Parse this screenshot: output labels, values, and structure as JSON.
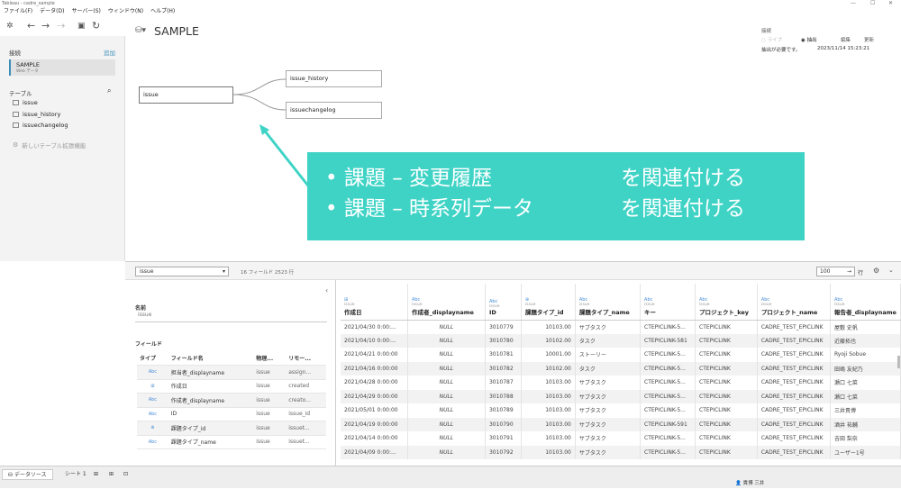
{
  "window": {
    "title": "Tableau - cadre_sample"
  },
  "menu": [
    "ファイル(F)",
    "データ(D)",
    "サーバー(S)",
    "ウィンドウ(N)",
    "ヘルプ(H)"
  ],
  "left": {
    "connections_label": "接続",
    "add_label": "追加",
    "connection_name": "SAMPLE",
    "connection_sub": "Web データ",
    "tables_label": "テーブル",
    "tables": [
      "issue",
      "issue_history",
      "issuechangelog"
    ],
    "new_table_ext": "新しいテーブル拡張機能"
  },
  "canvas": {
    "datasource_title": "SAMPLE",
    "connection_label": "接続",
    "live_label": "ライブ",
    "extract_label": "抽出",
    "edit_label": "編集",
    "refresh_label": "更新",
    "status": "抽出が必要です。",
    "timestamp": "2023/11/14 15:23:21",
    "main_table": "issue",
    "related_tables": [
      "issue_history",
      "issuechangelog"
    ]
  },
  "callout": {
    "rows": [
      [
        "• 課題 – 変更履歴",
        "を関連付ける"
      ],
      [
        "• 課題 – 時系列データ",
        "を関連付ける"
      ]
    ]
  },
  "lower": {
    "table_select": "issue",
    "field_count": "16 フィールド 2523 行",
    "rows_value": "100",
    "rows_label": "行"
  },
  "fieldpanel": {
    "name_label": "名前",
    "name_value": "issue",
    "fields_label": "フィールド",
    "headers": [
      "タイプ",
      "フィールド名",
      "物理...",
      "リモー..."
    ],
    "rows": [
      [
        "Abc",
        "担当者_displayname",
        "issue",
        "assign..."
      ],
      [
        "⊞",
        "作成日",
        "issue",
        "created"
      ],
      [
        "Abc",
        "作成者_displayname",
        "issue",
        "creato..."
      ],
      [
        "Abc",
        "ID",
        "issue",
        "issue_id"
      ],
      [
        "⊕",
        "課題タイプ_id",
        "issue",
        "issuet..."
      ],
      [
        "Abc",
        "課題タイプ_name",
        "issue",
        "issuet..."
      ]
    ]
  },
  "grid": {
    "columns": [
      {
        "icon": "⊞",
        "sub": "issue",
        "name": "作成日"
      },
      {
        "icon": "Abc",
        "sub": "issue",
        "name": "作成者_displayname"
      },
      {
        "icon": "Abc",
        "sub": "issue",
        "name": "ID"
      },
      {
        "icon": "⊕",
        "sub": "issue",
        "name": "課題タイプ_id"
      },
      {
        "icon": "Abc",
        "sub": "issue",
        "name": "課題タイプ_name"
      },
      {
        "icon": "Abc",
        "sub": "issue",
        "name": "キー"
      },
      {
        "icon": "Abc",
        "sub": "issue",
        "name": "プロジェクト_key"
      },
      {
        "icon": "Abc",
        "sub": "issue",
        "name": "プロジェクト_name"
      },
      {
        "icon": "Abc",
        "sub": "issue",
        "name": "報告者_displayname"
      }
    ],
    "rows": [
      [
        "2021/04/30 0:00:...",
        "NULL",
        "3010779",
        "10103.00",
        "サブタスク",
        "CTEPICLINK-5...",
        "CTEPICLINK",
        "CADRE_TEST_EPICLINK",
        "屋敷 史帆"
      ],
      [
        "2021/04/10 0:00:...",
        "NULL",
        "3010780",
        "10102.00",
        "タスク",
        "CTEPICLINK-581",
        "CTEPICLINK",
        "CADRE_TEST_EPICLINK",
        "近藤拓也"
      ],
      [
        "2021/04/21 0:00:00",
        "NULL",
        "3010781",
        "10001.00",
        "ストーリー",
        "CTEPICLINK-5...",
        "CTEPICLINK",
        "CADRE_TEST_EPICLINK",
        "Ryoji Sobue"
      ],
      [
        "2021/04/16 0:00:00",
        "NULL",
        "3010782",
        "10102.00",
        "タスク",
        "CTEPICLINK-5...",
        "CTEPICLINK",
        "CADRE_TEST_EPICLINK",
        "田嶋 友紀乃"
      ],
      [
        "2021/04/28 0:00:00",
        "NULL",
        "3010787",
        "10103.00",
        "サブタスク",
        "CTEPICLINK-5...",
        "CTEPICLINK",
        "CADRE_TEST_EPICLINK",
        "瀬口 七菜"
      ],
      [
        "2021/04/29 0:00:00",
        "NULL",
        "3010788",
        "10103.00",
        "サブタスク",
        "CTEPICLINK-5...",
        "CTEPICLINK",
        "CADRE_TEST_EPICLINK",
        "瀬口 七菜"
      ],
      [
        "2021/05/01 0:00:00",
        "NULL",
        "3010789",
        "10103.00",
        "サブタスク",
        "CTEPICLINK-5...",
        "CTEPICLINK",
        "CADRE_TEST_EPICLINK",
        "三井貴博"
      ],
      [
        "2021/04/19 0:00:00",
        "NULL",
        "3010790",
        "10103.00",
        "サブタスク",
        "CTEPICLINK-591",
        "CTEPICLINK",
        "CADRE_TEST_EPICLINK",
        "酒井 祐輔"
      ],
      [
        "2021/04/14 0:00:00",
        "NULL",
        "3010791",
        "10103.00",
        "サブタスク",
        "CTEPICLINK-5...",
        "CTEPICLINK",
        "CADRE_TEST_EPICLINK",
        "吉田 梨奈"
      ],
      [
        "2021/04/09 0:00:...",
        "NULL",
        "3010792",
        "10103.00",
        "サブタスク",
        "CTEPICLINK-5...",
        "CTEPICLINK",
        "CADRE_TEST_EPICLINK",
        "ユーザー1号"
      ]
    ]
  },
  "bottom": {
    "datasource_tab": "データソース",
    "sheet_tab": "シート 1",
    "user": "貴博 三井"
  },
  "colors": {
    "accent": "#3fd3c6",
    "selection": "#3a8fb7"
  }
}
